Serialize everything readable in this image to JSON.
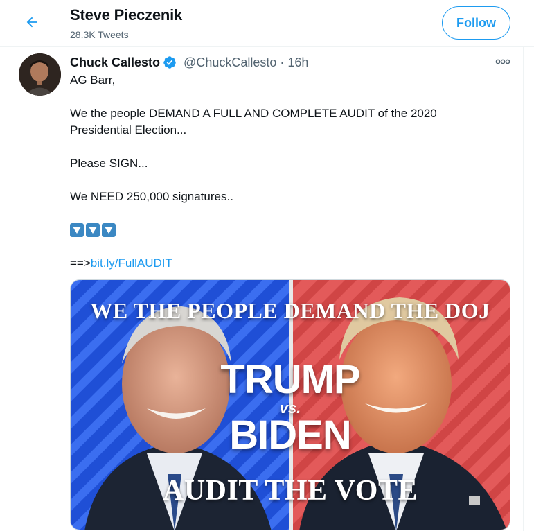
{
  "header": {
    "title": "Steve Pieczenik",
    "subtitle": "28.3K Tweets",
    "follow_label": "Follow"
  },
  "tweet": {
    "author_name": "Chuck Callesto",
    "handle": "@ChuckCallesto",
    "separator": "·",
    "time": "16h",
    "lines": {
      "l1": "AG Barr,",
      "l2": "We the people DEMAND A FULL AND COMPLETE AUDIT of the 2020 Presidential Election...",
      "l3": "Please SIGN...",
      "l4": "We NEED 250,000 signatures..",
      "l5_prefix": "==>",
      "link": "bit.ly/FullAUDIT"
    },
    "emoji": "down-arrow-button ×3"
  },
  "media": {
    "top_text": "WE THE PEOPLE DEMAND THE DOJ",
    "line1": "TRUMP",
    "vs": "vs.",
    "line2": "BIDEN",
    "bottom_text": "AUDIT THE VOTE"
  },
  "colors": {
    "accent": "#1d9bf0",
    "left_panel": "#1f4fd6",
    "right_panel": "#e35a5a",
    "emoji_blue": "#3b88c3"
  },
  "icons": [
    "back-arrow-icon",
    "verified-badge-icon",
    "more-options-icon",
    "down-arrow-emoji-icon"
  ]
}
